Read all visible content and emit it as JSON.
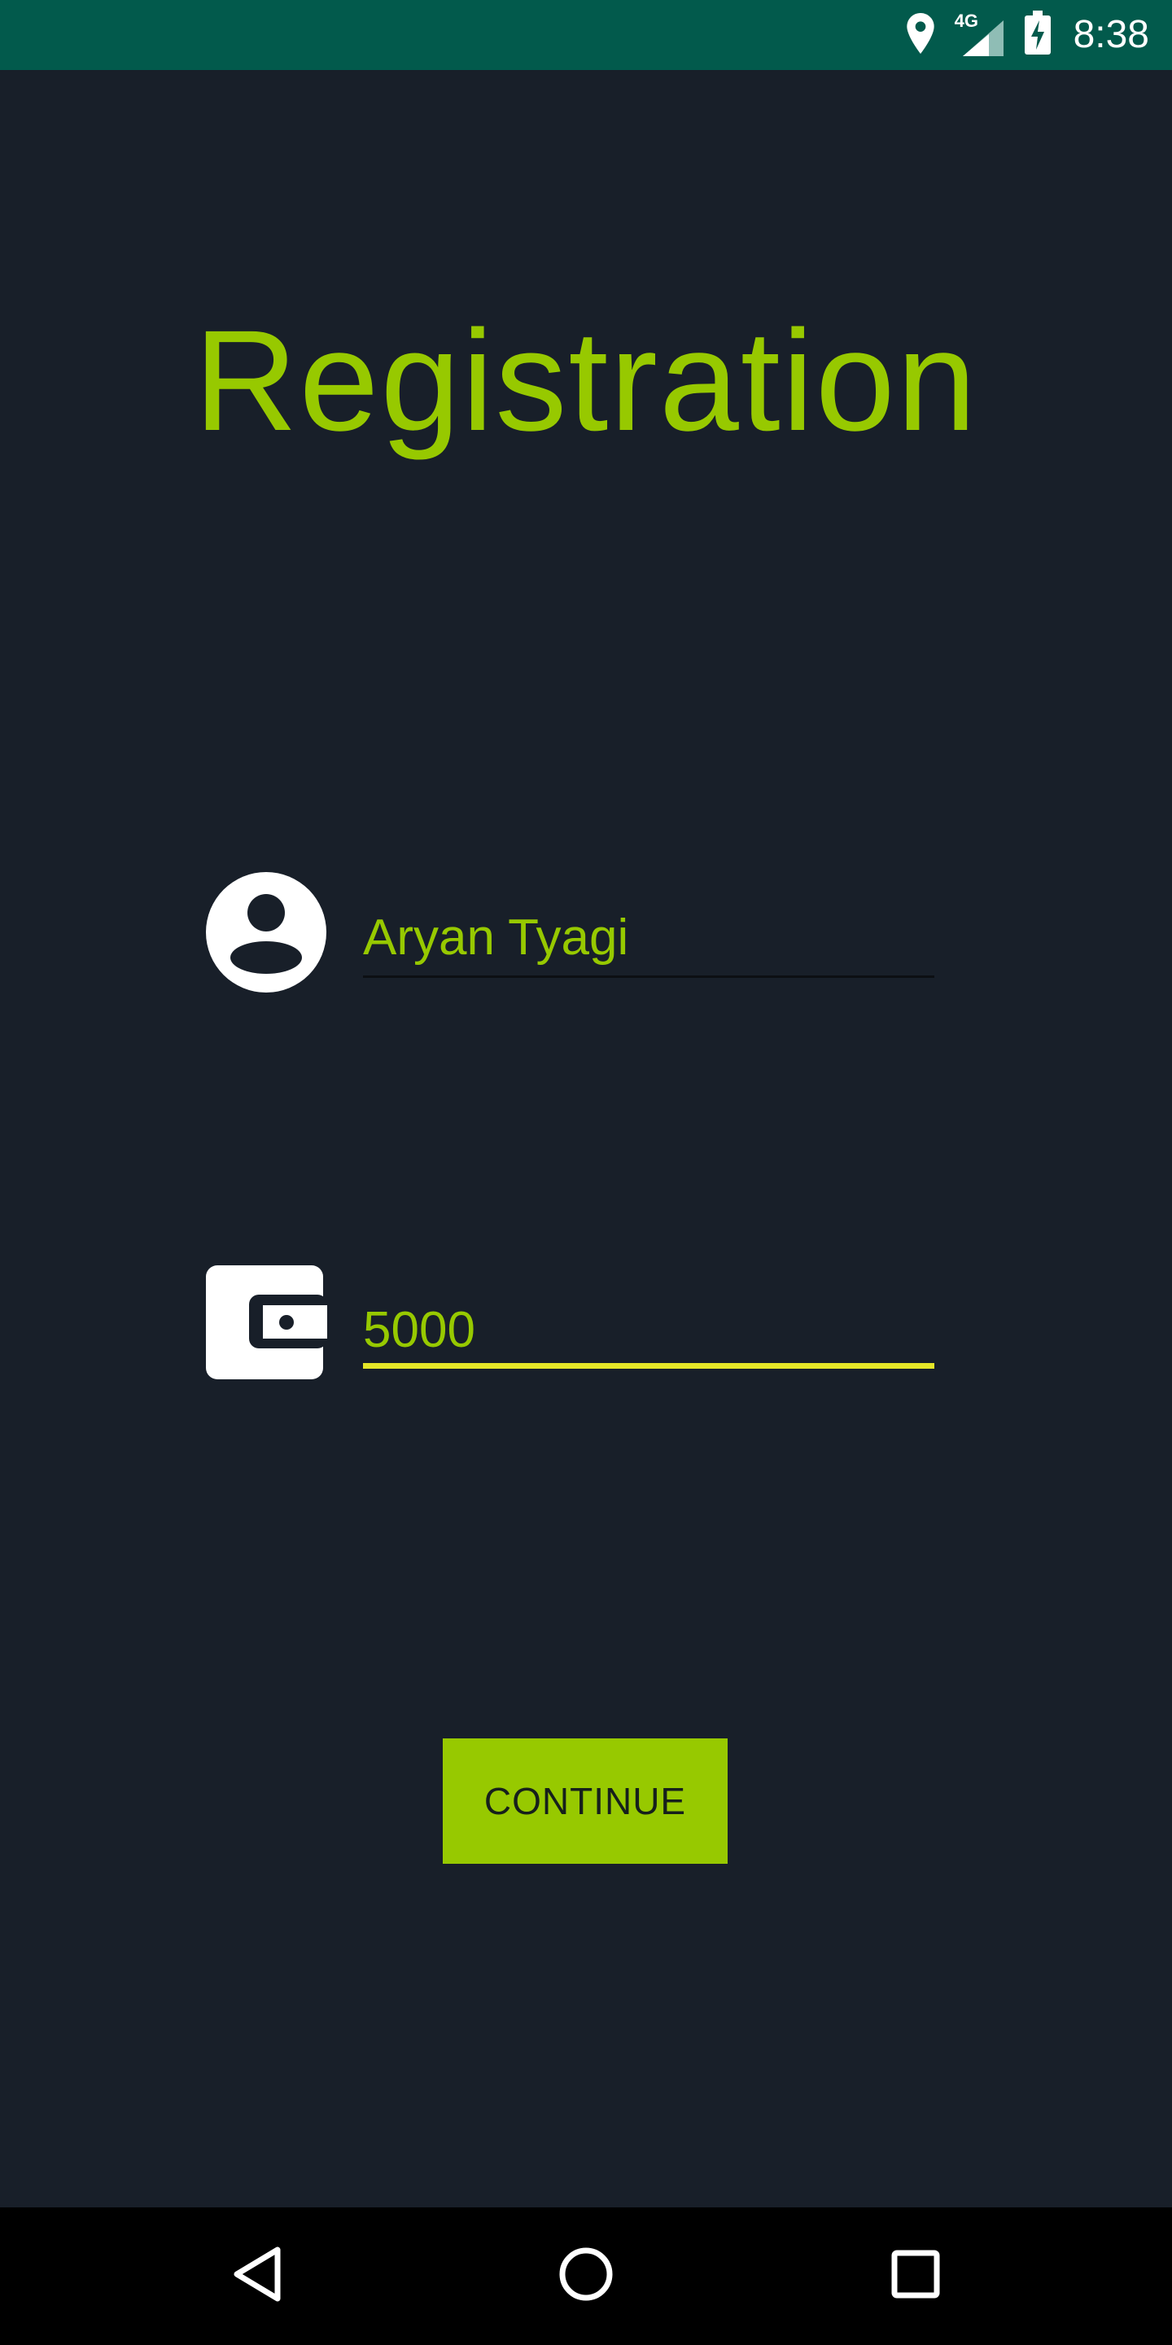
{
  "status_bar": {
    "time": "8:38",
    "network_type": "4G",
    "icons": [
      "location-icon",
      "signal-icon",
      "battery-charging-icon"
    ],
    "background_color": "#025a4c"
  },
  "page": {
    "title": "Registration",
    "accent_color": "#97c900",
    "background_color": "#181f29"
  },
  "form": {
    "name_field": {
      "icon": "account-circle-icon",
      "value": "Aryan Tyagi",
      "placeholder": ""
    },
    "amount_field": {
      "icon": "wallet-icon",
      "value": "5000",
      "placeholder": "",
      "focused": true,
      "focus_color": "#e5e628"
    }
  },
  "actions": {
    "continue_label": "CONTINUE"
  },
  "nav_bar": {
    "buttons": [
      "back-icon",
      "home-icon",
      "recents-icon"
    ]
  }
}
